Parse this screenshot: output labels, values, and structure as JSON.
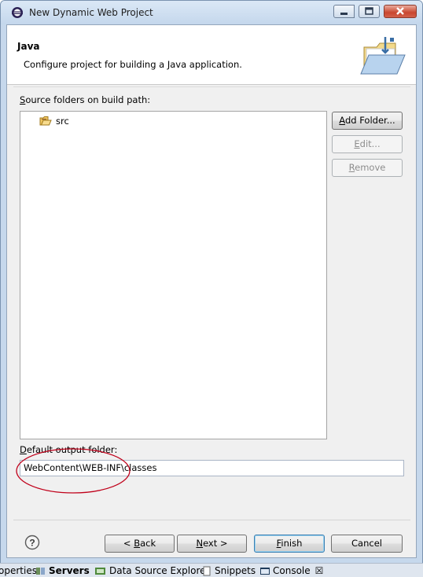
{
  "window": {
    "title": "New Dynamic Web Project"
  },
  "banner": {
    "title": "Java",
    "description": "Configure project for building a Java application."
  },
  "source_folders": {
    "label_prefix": "S",
    "label_rest": "ource folders on build path:",
    "items": [
      {
        "label": "src",
        "icon": "source-folder-icon"
      }
    ]
  },
  "side_buttons": {
    "add": {
      "mn": "A",
      "rest": "dd Folder...",
      "enabled": true
    },
    "edit": {
      "mn": "E",
      "rest": "dit...",
      "enabled": false
    },
    "remove": {
      "mn": "R",
      "rest": "emove",
      "enabled": false
    }
  },
  "output": {
    "label_prefix": "D",
    "label_rest": "efault output folder:",
    "value": "WebContent\\WEB-INF\\classes"
  },
  "annotation": {
    "shape": "red-ellipse",
    "color": "#c0001a"
  },
  "footer": {
    "back": {
      "pre": "< ",
      "mn": "B",
      "rest": "ack"
    },
    "next": {
      "mn": "N",
      "rest": "ext >"
    },
    "finish": {
      "mn": "F",
      "rest": "inish"
    },
    "cancel": {
      "label": "Cancel"
    }
  },
  "statusbar": {
    "items": [
      {
        "label": "operties",
        "icon": ""
      },
      {
        "label": "Servers",
        "icon": "servers-icon"
      },
      {
        "label": "Data Source Explorer",
        "icon": "data-source-icon"
      },
      {
        "label": "Snippets",
        "icon": "snippets-icon"
      },
      {
        "label": "Console",
        "icon": "console-icon"
      }
    ],
    "close_glyph": "☒"
  },
  "colors": {
    "accent": "#3c7fb1",
    "annotation": "#c0001a",
    "window_frame": "#c6d8ec"
  }
}
